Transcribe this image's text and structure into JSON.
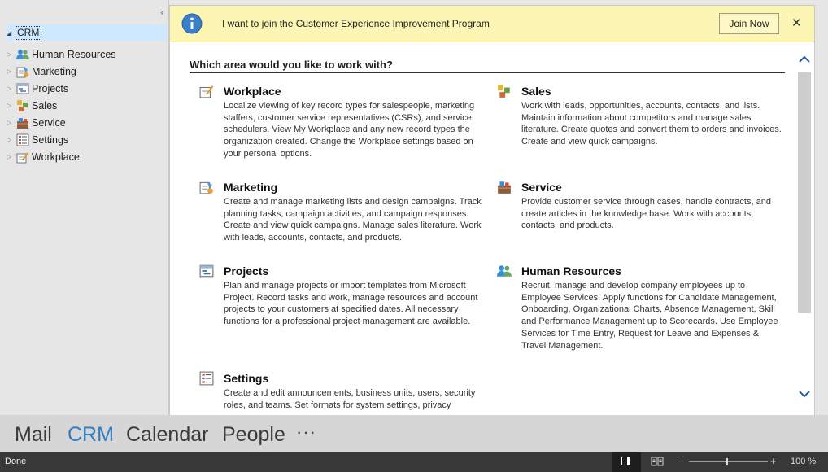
{
  "nav": {
    "collapse_glyph": "‹",
    "root_label": "CRM",
    "items": [
      {
        "label": "Human Resources",
        "icon": "people-icon"
      },
      {
        "label": "Marketing",
        "icon": "marketing-icon"
      },
      {
        "label": "Projects",
        "icon": "projects-icon"
      },
      {
        "label": "Sales",
        "icon": "sales-icon"
      },
      {
        "label": "Service",
        "icon": "service-icon"
      },
      {
        "label": "Settings",
        "icon": "settings-icon"
      },
      {
        "label": "Workplace",
        "icon": "workplace-icon"
      }
    ]
  },
  "info_bar": {
    "message": "I want to join the Customer Experience Improvement Program",
    "join_label": "Join Now",
    "close_glyph": "✕",
    "background": "#fcf5b4"
  },
  "main": {
    "heading": "Which area would you like to work with?",
    "areas": [
      {
        "title": "Workplace",
        "icon": "workplace-icon",
        "description": "Localize viewing of key record types for salespeople, marketing staffers, customer service representatives (CSRs), and service schedulers. View My Workplace and any new record types the organization created. Change the Workplace settings based on your personal options."
      },
      {
        "title": "Sales",
        "icon": "sales-icon",
        "description": "Work with leads, opportunities, accounts, contacts, and lists. Maintain information about competitors and manage sales literature. Create quotes and convert them to orders and invoices. Create and view quick campaigns."
      },
      {
        "title": "Marketing",
        "icon": "marketing-icon",
        "description": "Create and manage marketing lists and design campaigns. Track planning tasks, campaign activities, and campaign responses. Create and view quick campaigns. Manage sales literature. Work with leads, accounts, contacts, and products."
      },
      {
        "title": "Service",
        "icon": "service-icon",
        "description": "Provide customer service through cases, handle contracts, and create articles in the knowledge base. Work with accounts, contacts, and products."
      },
      {
        "title": "Projects",
        "icon": "projects-icon",
        "description": "Plan and manage projects or import templates from Microsoft Project. Record tasks and work, manage resources and account projects to your customers at specified dates. All necessary functions for a professional project management are available."
      },
      {
        "title": "Human Resources",
        "icon": "people-icon",
        "description": "Recruit, manage and develop company employees up to Employee Services. Apply functions for Candidate Management, Onboarding, Organizational Charts, Absence Management, Skill and Performance Management up to Scorecards. Use Employee Services for Time Entry, Request for Leave and Expenses & Travel Management."
      },
      {
        "title": "Settings",
        "icon": "settings-icon",
        "description": "Create and edit announcements, business units, users, security roles, and teams. Set formats for system settings, privacy"
      }
    ]
  },
  "app_bar": {
    "tabs": [
      "Mail",
      "CRM",
      "Calendar",
      "People"
    ],
    "active_tab": "CRM",
    "more_glyph": "···",
    "accent_color": "#2f7ec4"
  },
  "status_bar": {
    "text": "Done",
    "zoom_level": "100 %",
    "zoom_minus": "−",
    "zoom_plus": "+"
  }
}
